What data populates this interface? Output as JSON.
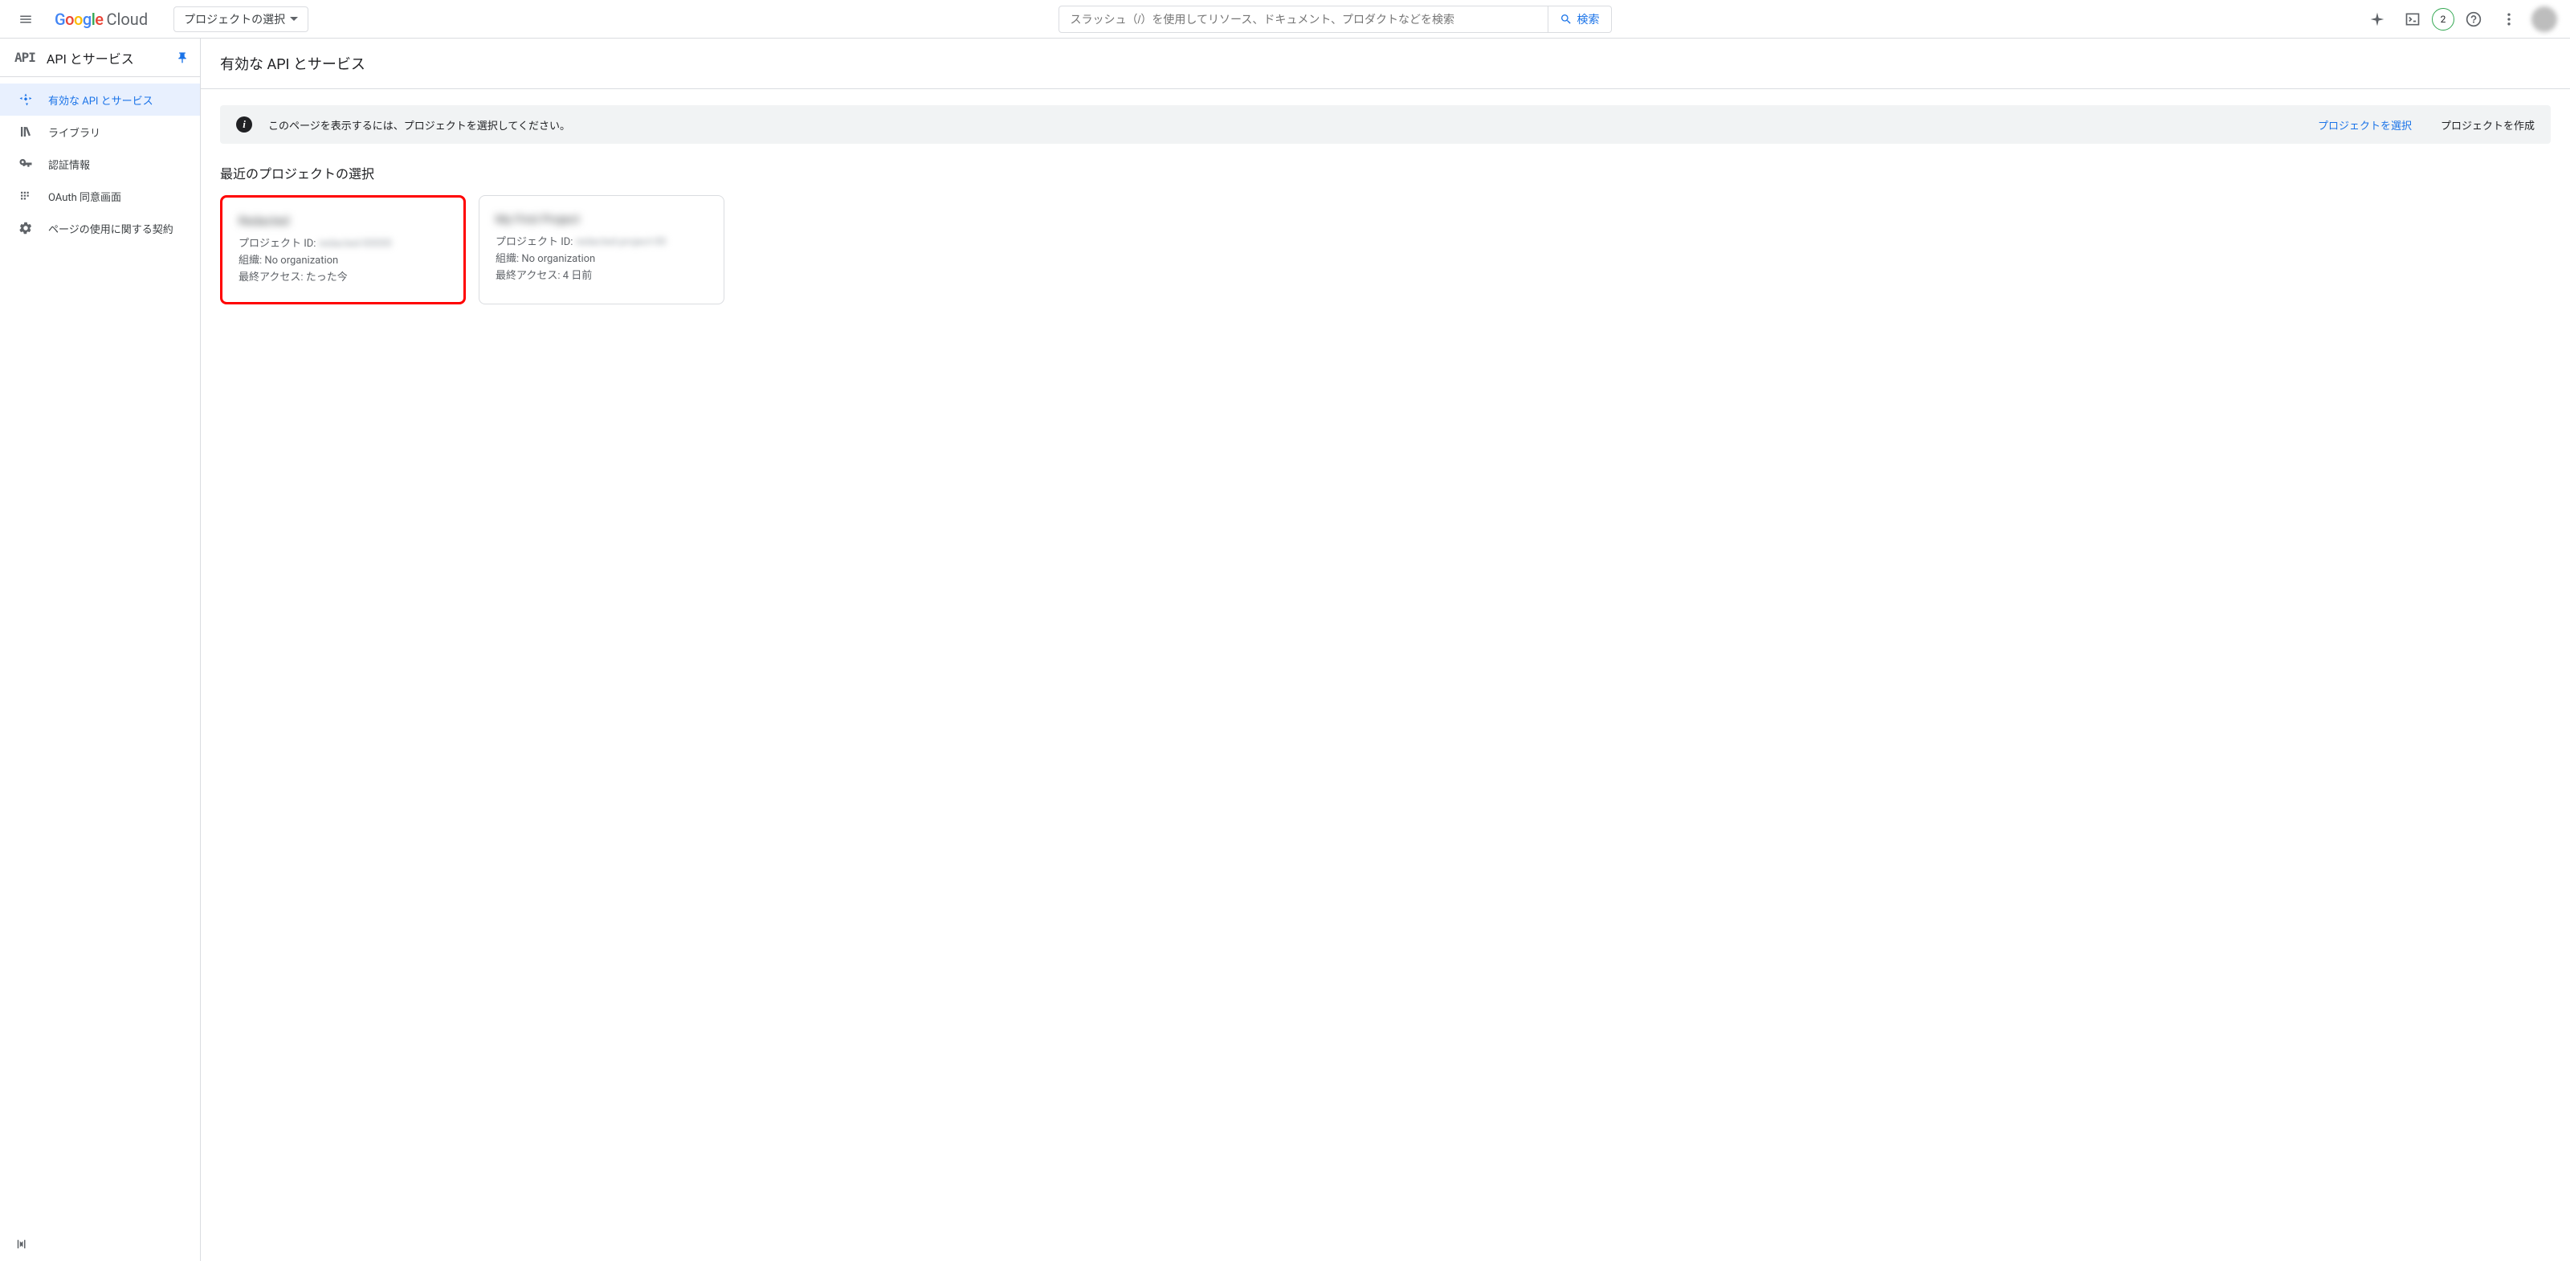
{
  "header": {
    "logo_cloud": "Cloud",
    "project_selector_label": "プロジェクトの選択",
    "search_placeholder": "スラッシュ（/）を使用してリソース、ドキュメント、プロダクトなどを検索",
    "search_button": "検索",
    "badge_count": "2"
  },
  "sidebar": {
    "api_logo": "API",
    "title": "API とサービス",
    "items": [
      {
        "label": "有効な API とサービス",
        "active": true
      },
      {
        "label": "ライブラリ",
        "active": false
      },
      {
        "label": "認証情報",
        "active": false
      },
      {
        "label": "OAuth 同意画面",
        "active": false
      },
      {
        "label": "ページの使用に関する契約",
        "active": false
      }
    ]
  },
  "main": {
    "page_title": "有効な API とサービス",
    "info_message": "このページを表示するには、プロジェクトを選択してください。",
    "info_select_link": "プロジェクトを選択",
    "info_create_link": "プロジェクトを作成",
    "section_title": "最近のプロジェクトの選択",
    "project_id_label": "プロジェクト ID:",
    "org_label": "組織:",
    "last_access_label": "最終アクセス:",
    "cards": [
      {
        "title": "Redacted",
        "project_id": "redacted-00000",
        "org": "No organization",
        "last_access": "たった今"
      },
      {
        "title": "My First Project",
        "project_id": "redacted-project-00",
        "org": "No organization",
        "last_access": "4 日前"
      }
    ]
  }
}
